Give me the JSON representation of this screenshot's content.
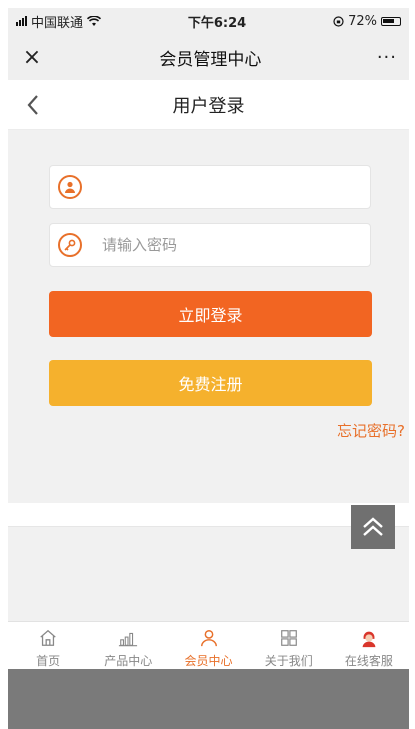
{
  "status_bar": {
    "carrier": "中国联通",
    "time": "下午6:24",
    "battery": "72%",
    "wifi_icon": "wifi-icon",
    "signal_icon": "signal-icon",
    "lock_icon": "rotation-lock-icon"
  },
  "nav": {
    "title": "会员管理中心",
    "close_icon": "×",
    "more_icon": "···"
  },
  "header": {
    "title": "用户登录"
  },
  "form": {
    "username": {
      "value": "",
      "placeholder": "",
      "icon": "user-icon"
    },
    "password": {
      "value": "",
      "placeholder": "请输入密码",
      "icon": "key-icon"
    },
    "login_label": "立即登录",
    "register_label": "免费注册",
    "forgot_label": "忘记密码?"
  },
  "tabs": [
    {
      "label": "首页",
      "icon": "home-icon"
    },
    {
      "label": "产品中心",
      "icon": "bar-chart-icon"
    },
    {
      "label": "会员中心",
      "icon": "user-icon",
      "active": true
    },
    {
      "label": "关于我们",
      "icon": "grid-icon"
    },
    {
      "label": "在线客服",
      "icon": "service-agent-icon"
    }
  ],
  "colors": {
    "accent": "#e8702a",
    "login_button": "#f26522",
    "register_button": "#f5b12d"
  }
}
